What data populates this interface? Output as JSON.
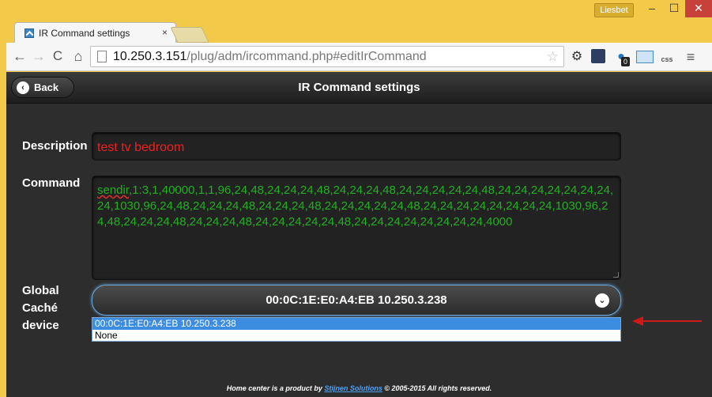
{
  "window": {
    "user": "Liesbet",
    "min": "‒",
    "max": "☐",
    "close": "✕"
  },
  "tab": {
    "title": "IR Command settings",
    "close": "×"
  },
  "toolbar": {
    "back": "←",
    "forward": "→",
    "reload": "C",
    "home": "⌂",
    "url_host": "10.250.3.151",
    "url_path": "/plug/adm/ircommand.php#editIrCommand",
    "star": "☆",
    "ext_badge": "0",
    "ext_css": "css",
    "menu": "≡"
  },
  "header": {
    "back_label": "Back",
    "back_icon": "‹",
    "title": "IR Command settings"
  },
  "form": {
    "description_label": "Description",
    "description_value": "test tv bedroom",
    "command_label": "Command",
    "command_first": "sendir",
    "command_rest": ",1:3,1,40000,1,1,96,24,48,24,24,24,48,24,24,24,48,24,24,24,24,24,48,24,24,24,24,24,24,24,24,1030,96,24,48,24,24,24,48,24,24,24,48,24,24,24,24,24,48,24,24,24,24,24,24,24,24,1030,96,24,48,24,24,24,48,24,24,24,48,24,24,24,24,24,48,24,24,24,24,24,24,24,24,4000",
    "gc_label": "Global Caché device",
    "gc_selected": "00:0C:1E:E0:A4:EB 10.250.3.238",
    "gc_options": [
      "00:0C:1E:E0:A4:EB 10.250.3.238",
      "None"
    ],
    "chevron": "⌄"
  },
  "footer": {
    "prefix": "Home center is a product by ",
    "link": "Stijnen Solutions",
    "suffix": " © 2005-2015 All rights reserved."
  },
  "colors": {
    "description_text": "#f02020",
    "command_text": "#22b022",
    "selected_option": "#3c8de0",
    "arrow": "#d01818"
  }
}
